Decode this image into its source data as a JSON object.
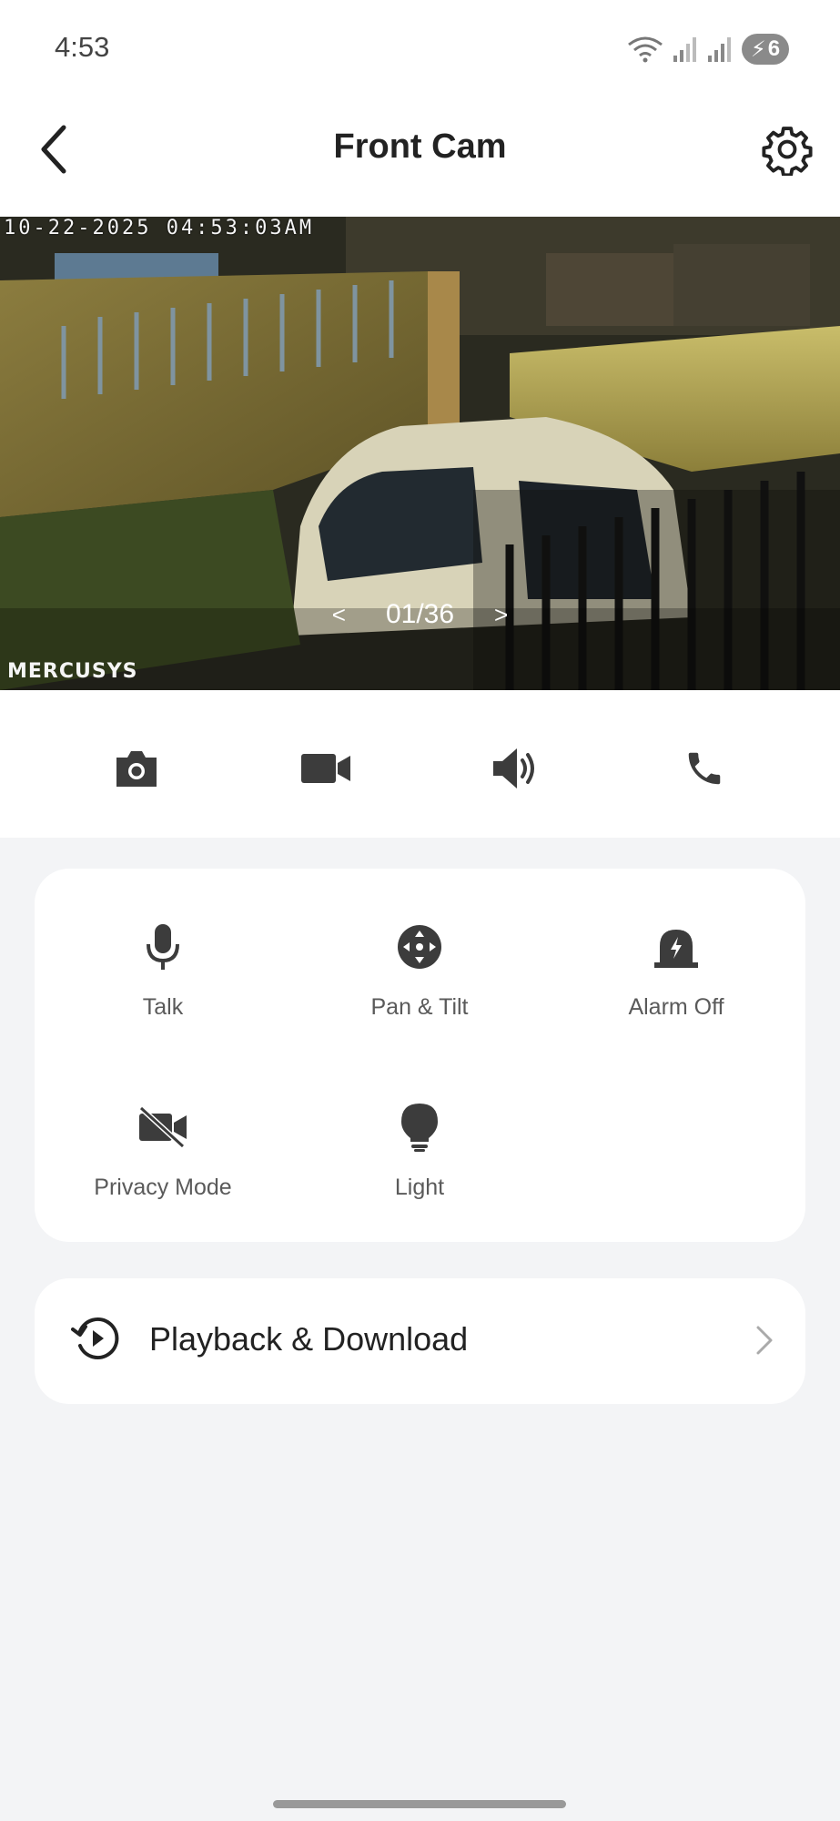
{
  "status_bar": {
    "time": "4:53",
    "battery_level": "6",
    "icons": [
      "wifi-icon",
      "signal-icon",
      "signal-icon",
      "battery-charging-icon"
    ]
  },
  "header": {
    "title": "Front Cam",
    "back_icon": "chevron-left-icon",
    "settings_icon": "gear-icon"
  },
  "video": {
    "timestamp": "10-22-2025 04:53:03AM",
    "brand": "MERCUSYS",
    "pager": {
      "prev": "<",
      "current": "01/36",
      "next": ">"
    }
  },
  "action_bar": {
    "items": [
      {
        "icon": "camera-icon"
      },
      {
        "icon": "video-record-icon"
      },
      {
        "icon": "speaker-icon"
      },
      {
        "icon": "phone-icon"
      }
    ]
  },
  "controls": {
    "items": [
      {
        "label": "Talk",
        "icon": "microphone-icon"
      },
      {
        "label": "Pan & Tilt",
        "icon": "pan-tilt-icon"
      },
      {
        "label": "Alarm Off",
        "icon": "alarm-icon"
      },
      {
        "label": "Privacy Mode",
        "icon": "video-off-icon"
      },
      {
        "label": "Light",
        "icon": "lightbulb-icon"
      }
    ]
  },
  "playback": {
    "label": "Playback & Download",
    "icon": "history-play-icon"
  },
  "colors": {
    "background": "#f3f4f6",
    "card": "#ffffff",
    "icon": "#3c3c3c",
    "text_primary": "#222222",
    "text_secondary": "#5a5a5a"
  }
}
